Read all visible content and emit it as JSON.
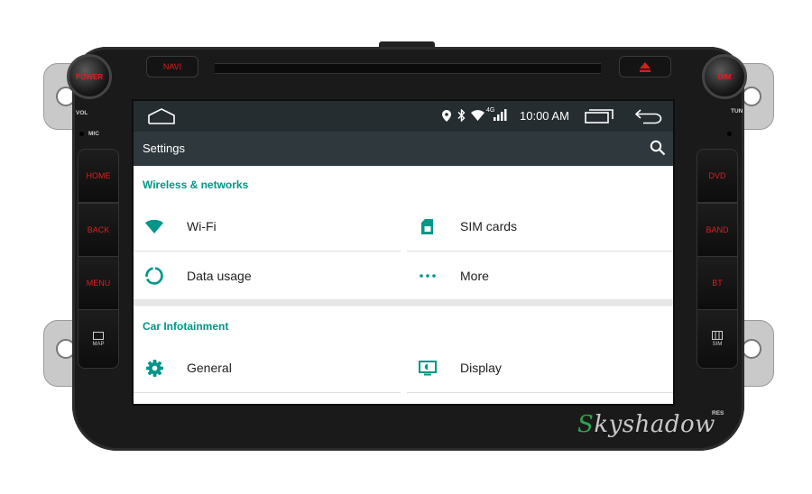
{
  "hardware": {
    "power_label": "POWER",
    "navi_label": "NAVI",
    "dim_label": "DIM",
    "vol_label": "VOL",
    "mic_label": "MIC",
    "tun_label": "TUN",
    "res_label": "RES",
    "left_buttons": [
      {
        "label": "HOME"
      },
      {
        "label": "BACK"
      },
      {
        "label": "MENU"
      },
      {
        "label": "MAP"
      }
    ],
    "right_buttons": [
      {
        "label": "DVD"
      },
      {
        "label": "BAND"
      },
      {
        "label": "BT"
      },
      {
        "label": "SIM"
      }
    ],
    "button_color": "#e01e1e"
  },
  "statusbar": {
    "time": "10:00 AM",
    "network_label": "4G"
  },
  "appbar": {
    "title": "Settings"
  },
  "sections": [
    {
      "title": "Wireless & networks",
      "items": [
        {
          "label": "Wi-Fi",
          "icon": "wifi-icon"
        },
        {
          "label": "SIM cards",
          "icon": "sim-card-icon"
        },
        {
          "label": "Data usage",
          "icon": "data-usage-icon"
        },
        {
          "label": "More",
          "icon": "more-dots-icon"
        }
      ]
    },
    {
      "title": "Car Infotainment",
      "items": [
        {
          "label": "General",
          "icon": "gear-icon"
        },
        {
          "label": "Display",
          "icon": "display-icon"
        }
      ]
    }
  ],
  "accent_color": "#009688",
  "watermark": {
    "first": "S",
    "rest": "kyshadow"
  }
}
